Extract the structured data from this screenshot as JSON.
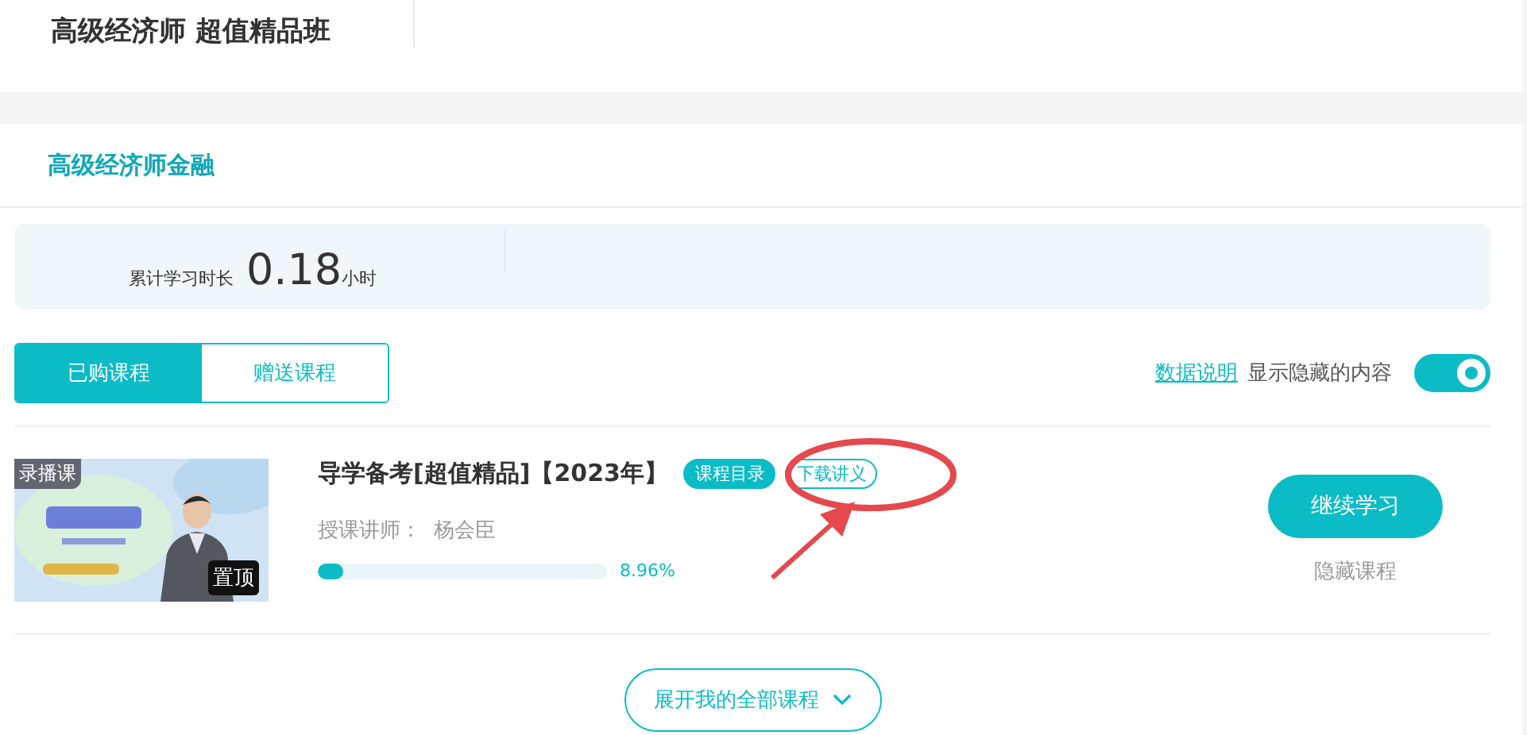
{
  "header": {
    "title": "高级经济师 超值精品班"
  },
  "section": {
    "title": "高级经济师金融"
  },
  "stats": {
    "label": "累计学习时长",
    "value": "0.18",
    "unit": "小时"
  },
  "tabs": [
    {
      "label": "已购课程",
      "selected": true
    },
    {
      "label": "赠送课程",
      "selected": false
    }
  ],
  "options": {
    "link": "数据说明",
    "toggle_label": "显示隐藏的内容",
    "toggle_on": true
  },
  "courses": [
    {
      "type_badge": "录播课",
      "pin_label": "置顶",
      "title": "导学备考[超值精品]【2023年】",
      "tags": [
        {
          "label": "课程目录",
          "kind": "filled"
        },
        {
          "label": "下载讲义",
          "kind": "outline"
        }
      ],
      "teacher_label": "授课讲师：",
      "teacher": "杨会臣",
      "level": 0.0896,
      "percent": "8.96%",
      "continue_button": "继续学习",
      "hide_link": "隐藏课程"
    }
  ],
  "expand_button": "展开我的全部课程"
}
